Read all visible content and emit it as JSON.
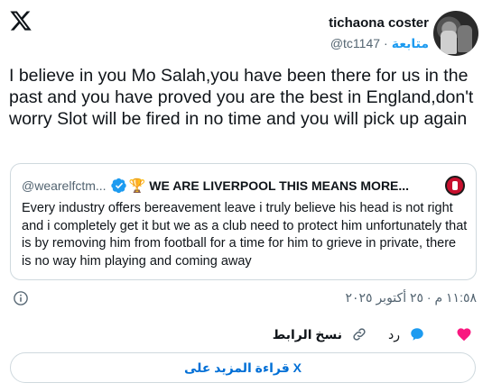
{
  "author": {
    "display_name": "tichaona coster",
    "handle": "@tc1147",
    "separator": "·",
    "follow_label": "متابعة"
  },
  "tweet": {
    "text": "I believe in you Mo Salah,you have been there for us in the past and you have proved you are the best in England,don't worry Slot will be fired in no time and you will pick up again"
  },
  "quoted": {
    "handle": "@wearelfctm...",
    "trophy": "🏆",
    "name": "WE ARE LIVERPOOL THIS MEANS MORE...",
    "text": "Every industry offers bereavement leave i truly believe his head is not right and i completely get it but we as a club  need to protect him unfortunately that is by removing him from football for a time for him to grieve in private, there is no way him playing and coming away"
  },
  "meta": {
    "timestamp": "١١:٥٨ م · ٢٥ أكتوبر ٢٠٢٥"
  },
  "actions": {
    "reply_label": "رد",
    "copy_link_label": "نسخ الرابط"
  },
  "read_more_label": "قراءة المزيد على X",
  "colors": {
    "accent": "#1d9bf0",
    "like": "#f91880",
    "text": "#0f1419",
    "muted": "#536471",
    "border": "#cfd9de"
  },
  "icons": [
    "x-logo-icon",
    "verified-badge-icon",
    "trophy-icon",
    "info-icon",
    "heart-icon",
    "reply-bubble-icon",
    "link-icon"
  ]
}
